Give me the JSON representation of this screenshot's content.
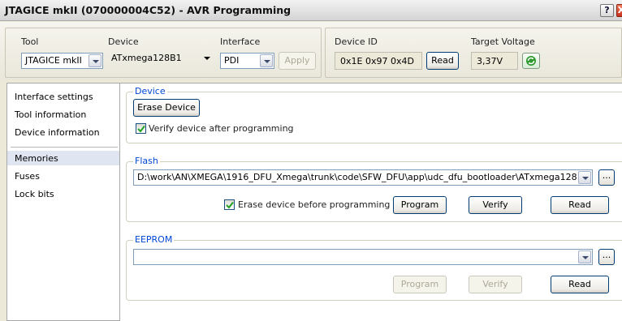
{
  "window": {
    "title": "JTAGICE mkII (070000004C52) - AVR Programming",
    "help_label": "?",
    "close_label": "X"
  },
  "toolbar": {
    "tool_label": "Tool",
    "tool_value": "JTAGICE mkII",
    "device_label": "Device",
    "device_value": "ATxmega128B1",
    "interface_label": "Interface",
    "interface_value": "PDI",
    "apply_label": "Apply",
    "device_id_label": "Device ID",
    "device_id_value": "0x1E 0x97 0x4D",
    "read_label": "Read",
    "target_voltage_label": "Target Voltage",
    "target_voltage_value": "3,37V",
    "refresh_icon": "refresh-icon"
  },
  "sidebar": {
    "items": [
      {
        "label": "Interface settings",
        "selected": false
      },
      {
        "label": "Tool information",
        "selected": false
      },
      {
        "label": "Device information",
        "selected": false
      },
      {
        "label": "Memories",
        "selected": true
      },
      {
        "label": "Fuses",
        "selected": false
      },
      {
        "label": "Lock bits",
        "selected": false
      }
    ]
  },
  "device_section": {
    "legend": "Device",
    "erase_button": "Erase Device",
    "verify_checkbox_label": "Verify device after programming",
    "verify_checked": true
  },
  "flash_section": {
    "legend": "Flash",
    "file_path": "D:\\work\\AN\\XMEGA\\1916_DFU_Xmega\\trunk\\code\\SFW_DFU\\app\\udc_dfu_bootloader\\ATxmega128",
    "browse_label": "...",
    "erase_checkbox_label": "Erase device before programming",
    "erase_checked": true,
    "program_label": "Program",
    "verify_label": "Verify",
    "read_label": "Read"
  },
  "eeprom_section": {
    "legend": "EEPROM",
    "file_path": "",
    "browse_label": "...",
    "program_label": "Program",
    "verify_label": "Verify",
    "read_label": "Read"
  }
}
